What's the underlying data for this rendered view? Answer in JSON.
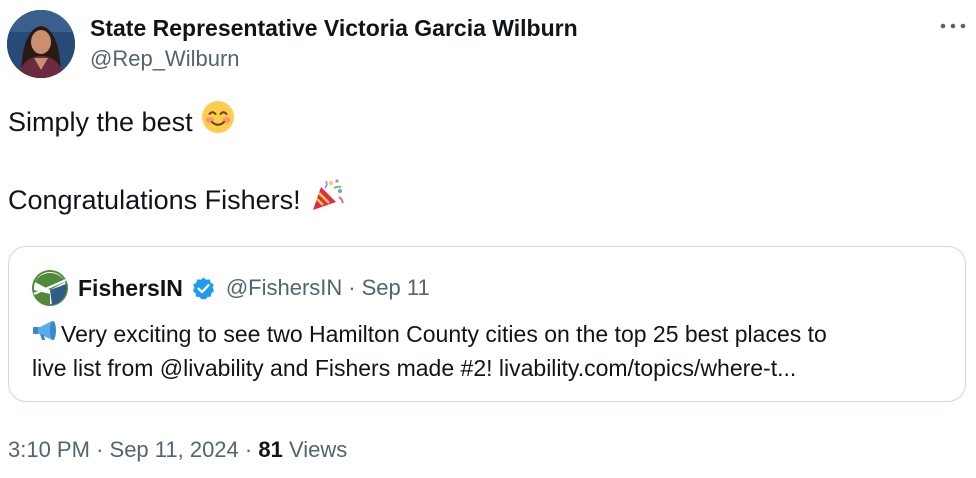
{
  "author": {
    "name": "State Representative Victoria Garcia Wilburn",
    "handle": "@Rep_Wilburn",
    "avatar_icon": "avatar-photo"
  },
  "tweet": {
    "line1": "Simply the best",
    "line1_emoji": "smiling-face-icon",
    "line2": "Congratulations Fishers!",
    "line2_emoji": "party-popper-icon"
  },
  "quote": {
    "name": "FishersIN",
    "verified_icon": "verified-badge-icon",
    "handle": "@FishersIN",
    "separator": "·",
    "date": "Sep 11",
    "emoji": "megaphone-icon",
    "line1": "Very exciting to see two Hamilton County cities on the top 25 best places to",
    "line2": "live list from @livability and Fishers made #2! livability.com/topics/where-t..."
  },
  "footer": {
    "time": "3:10 PM",
    "sep1": "·",
    "date": "Sep 11, 2024",
    "sep2": "·",
    "views_count": "81",
    "views_label": "Views"
  },
  "colors": {
    "text": "#0f1419",
    "secondary": "#536471",
    "border": "#cfd9de",
    "verified": "#1d9bf0",
    "logo_green": "#4f8a3a",
    "logo_blue": "#2f5d8a"
  }
}
